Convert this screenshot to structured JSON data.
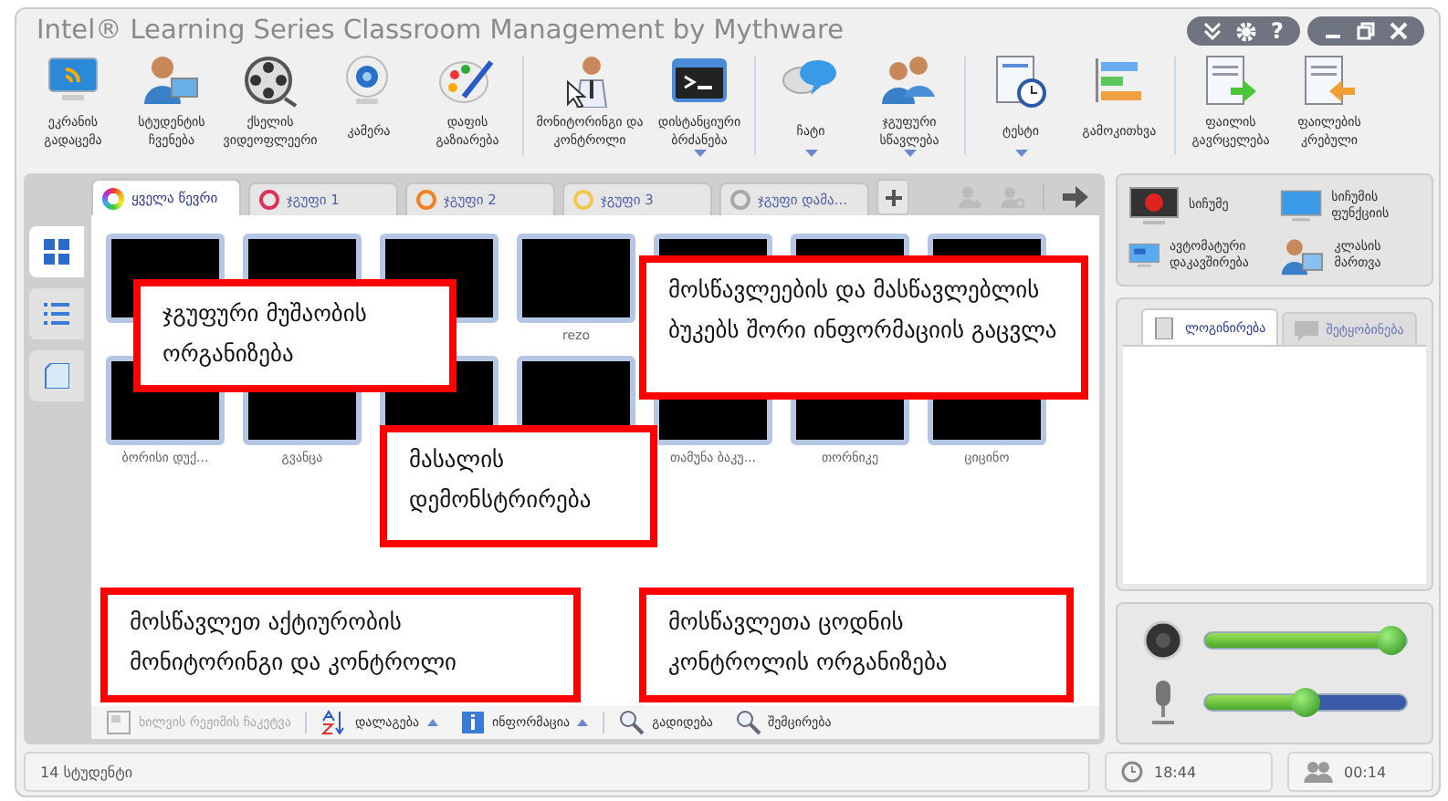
{
  "window": {
    "title": "Intel® Learning Series Classroom Management by Mythware",
    "help": "?"
  },
  "toolbar_groups": [
    [
      {
        "label": "ეკრანის გადაცემა",
        "dropdown": false
      },
      {
        "label": "სტუდენტის ჩვენება",
        "dropdown": false
      },
      {
        "label": "ქსელის ვიდეოფლეერი",
        "dropdown": false
      },
      {
        "label": "კამერა",
        "dropdown": false
      },
      {
        "label": "დაფის გაზიარება",
        "dropdown": false
      }
    ],
    [
      {
        "label": "მონიტორინგი და კონტროლი",
        "dropdown": false
      },
      {
        "label": "დისტანციური ბრძანება",
        "dropdown": true
      }
    ],
    [
      {
        "label": "ჩატი",
        "dropdown": true
      },
      {
        "label": "ჯგუფური სწავლება",
        "dropdown": true
      }
    ],
    [
      {
        "label": "ტესტი",
        "dropdown": true
      },
      {
        "label": "გამოკითხვა",
        "dropdown": false
      }
    ],
    [
      {
        "label": "ფაილის გავრცელება",
        "dropdown": false
      },
      {
        "label": "ფაილების კრებული",
        "dropdown": false
      }
    ]
  ],
  "view_buttons": [
    {
      "selected": true
    },
    {
      "selected": false
    },
    {
      "selected": false
    }
  ],
  "tabs": [
    {
      "label": "ყველა წევრი",
      "kind": "all",
      "selected": true
    },
    {
      "label": "ჯგუფი 1",
      "kind": "group",
      "color": "#e0305a",
      "selected": false
    },
    {
      "label": "ჯგუფი 2",
      "kind": "group",
      "color": "#f08020",
      "selected": false
    },
    {
      "label": "ჯგუფი 3",
      "kind": "group",
      "color": "#f0c850",
      "selected": false
    },
    {
      "label": "ჯგუფი დამა...",
      "kind": "group",
      "color": "#a8a8a8",
      "selected": false
    }
  ],
  "students": [
    {
      "kind": "covered"
    },
    {
      "kind": "covered"
    },
    {
      "kind": "covered"
    },
    {
      "kind": "named",
      "name": "rezo"
    },
    {
      "kind": "covered"
    },
    {
      "kind": "covered"
    },
    {
      "kind": "covered"
    },
    {
      "kind": "named",
      "name": "ბორისი დუქ..."
    },
    {
      "kind": "named",
      "name": "გვანცა"
    },
    {
      "kind": "covered"
    },
    {
      "kind": "covered"
    },
    {
      "kind": "named",
      "name": "თამუნა ბაკუ..."
    },
    {
      "kind": "named",
      "name": "თორნიკე"
    },
    {
      "kind": "named",
      "name": "ციცინო"
    }
  ],
  "callouts": [
    "ჯგუფური მუშაობის ორგანიზება",
    "მოსწავლეების და მასწავლებლის ბუკებს შორი ინფორმაციის გაცვლა",
    "მასალის დემონსტრირება",
    "მოსწავლეთ აქტიურობის მონიტორინგი და კონტროლი",
    "მოსწავლეთა ცოდნის კონტროლის ორგანიზება"
  ],
  "canvas_toolbar": [
    {
      "label": "ხილვის რეჟიმის ჩაკეტვა",
      "disabled": true,
      "dropdown": false
    },
    {
      "label": "დალაგება",
      "disabled": false,
      "dropdown": true
    },
    {
      "label": "ინფორმაცია",
      "disabled": false,
      "dropdown": true
    },
    {
      "label": "გადიდება",
      "disabled": false,
      "dropdown": false
    },
    {
      "label": "შემცირება",
      "disabled": false,
      "dropdown": false
    }
  ],
  "quick_buttons": [
    {
      "label": "სიჩუმე"
    },
    {
      "label": "სიჩუმის ფუნქციის"
    },
    {
      "label": "ავტომატური დაკავშირება"
    },
    {
      "label": "კლასის მართვა"
    }
  ],
  "right_tabs": [
    {
      "label": "ლოგინირება",
      "selected": true
    },
    {
      "label": "შეტყობინება",
      "selected": false
    }
  ],
  "audio": [
    {
      "kind": "speaker",
      "level": 1.0
    },
    {
      "kind": "microphone",
      "level": 0.5
    }
  ],
  "status_bar": {
    "students": "14 სტუდენტი",
    "clock": "18:44",
    "duration": "00:14"
  }
}
